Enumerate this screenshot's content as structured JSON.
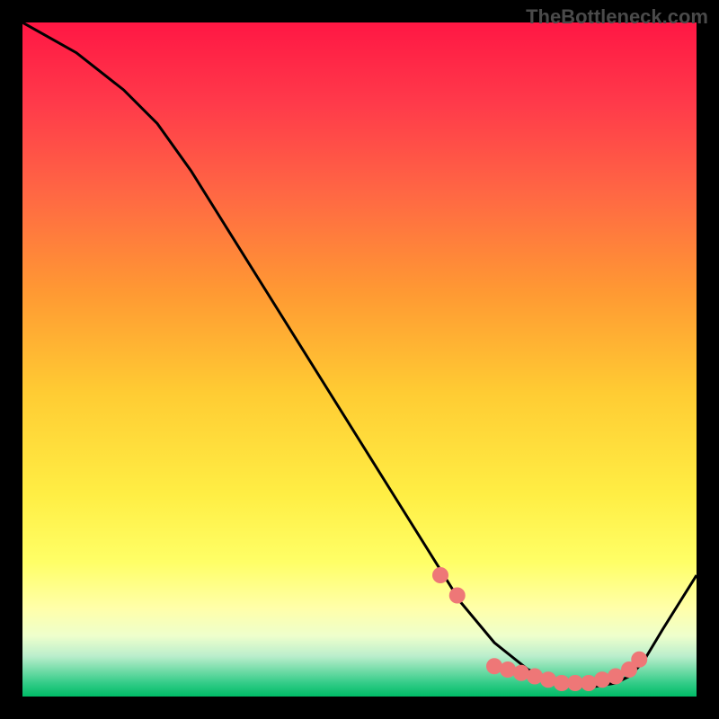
{
  "watermark": "TheBottleneck.com",
  "chart_data": {
    "type": "line",
    "title": "",
    "xlabel": "",
    "ylabel": "",
    "xlim": [
      0,
      100
    ],
    "ylim": [
      0,
      100
    ],
    "series": [
      {
        "name": "curve",
        "x": [
          0,
          8,
          15,
          20,
          25,
          30,
          35,
          40,
          45,
          50,
          55,
          60,
          62.5,
          65,
          70,
          75,
          80,
          82,
          85,
          88,
          90,
          92,
          95,
          100
        ],
        "y": [
          100,
          95.5,
          90,
          85,
          78,
          70,
          62,
          54,
          46,
          38,
          30,
          22,
          18,
          14,
          8,
          4,
          2,
          1.5,
          1.5,
          2,
          3,
          5,
          10,
          18
        ]
      }
    ],
    "scatter": [
      {
        "name": "dots",
        "x": [
          62,
          64.5,
          70,
          72,
          74,
          76,
          78,
          80,
          82,
          84,
          86,
          88,
          90,
          91.5
        ],
        "y": [
          18,
          15,
          4.5,
          4,
          3.5,
          3,
          2.5,
          2,
          2,
          2,
          2.5,
          3,
          4,
          5.5
        ]
      }
    ],
    "gradient_colors": {
      "top": "#ff1744",
      "upper_mid": "#ff5050",
      "mid": "#ff9933",
      "lower_mid": "#ffdd33",
      "near_bottom": "#ffff66",
      "light_yellow": "#ffffcc",
      "pale_green": "#ccffcc",
      "green": "#33dd77",
      "bottom": "#00cc66"
    },
    "dot_color": "#ee7777",
    "curve_color": "#000000"
  }
}
